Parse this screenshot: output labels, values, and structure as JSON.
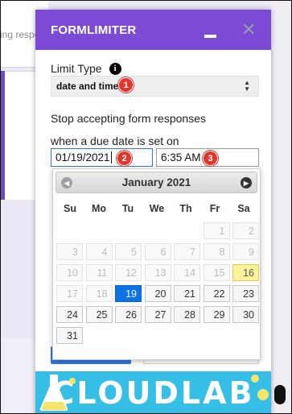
{
  "background": {
    "partial_text": "ing respo"
  },
  "panel": {
    "title": "FORMLIMITER"
  },
  "form": {
    "limit_type_label": "Limit Type",
    "limit_type_value": "date and time",
    "desc_line1": "Stop accepting form responses",
    "desc_line2": "when a due date is set on",
    "date_value": "01/19/2021",
    "time_value": "6:35 AM"
  },
  "badges": [
    "1",
    "2",
    "3"
  ],
  "calendar": {
    "month_label": "January 2021",
    "weekdays": [
      "Su",
      "Mo",
      "Tu",
      "We",
      "Th",
      "Fr",
      "Sa"
    ],
    "selected_day": 19,
    "today_day": 16,
    "weeks": [
      [
        null,
        null,
        null,
        null,
        null,
        "1",
        "2"
      ],
      [
        "3",
        "4",
        "5",
        "6",
        "7",
        "8",
        "9"
      ],
      [
        "10",
        "11",
        "12",
        "13",
        "14",
        "15",
        "16"
      ],
      [
        "17",
        "18",
        "19",
        "20",
        "21",
        "22",
        "23"
      ],
      [
        "24",
        "25",
        "26",
        "27",
        "28",
        "29",
        "30"
      ],
      [
        "31",
        null,
        null,
        null,
        null,
        null,
        null
      ]
    ]
  },
  "banner": {
    "text": "CLOUDLAB"
  },
  "colors": {
    "header": "#7b4bd6",
    "badge": "#e0362c",
    "selected_day": "#0b72e8",
    "today_day": "#fbf39a",
    "banner": "#36bfe6"
  }
}
